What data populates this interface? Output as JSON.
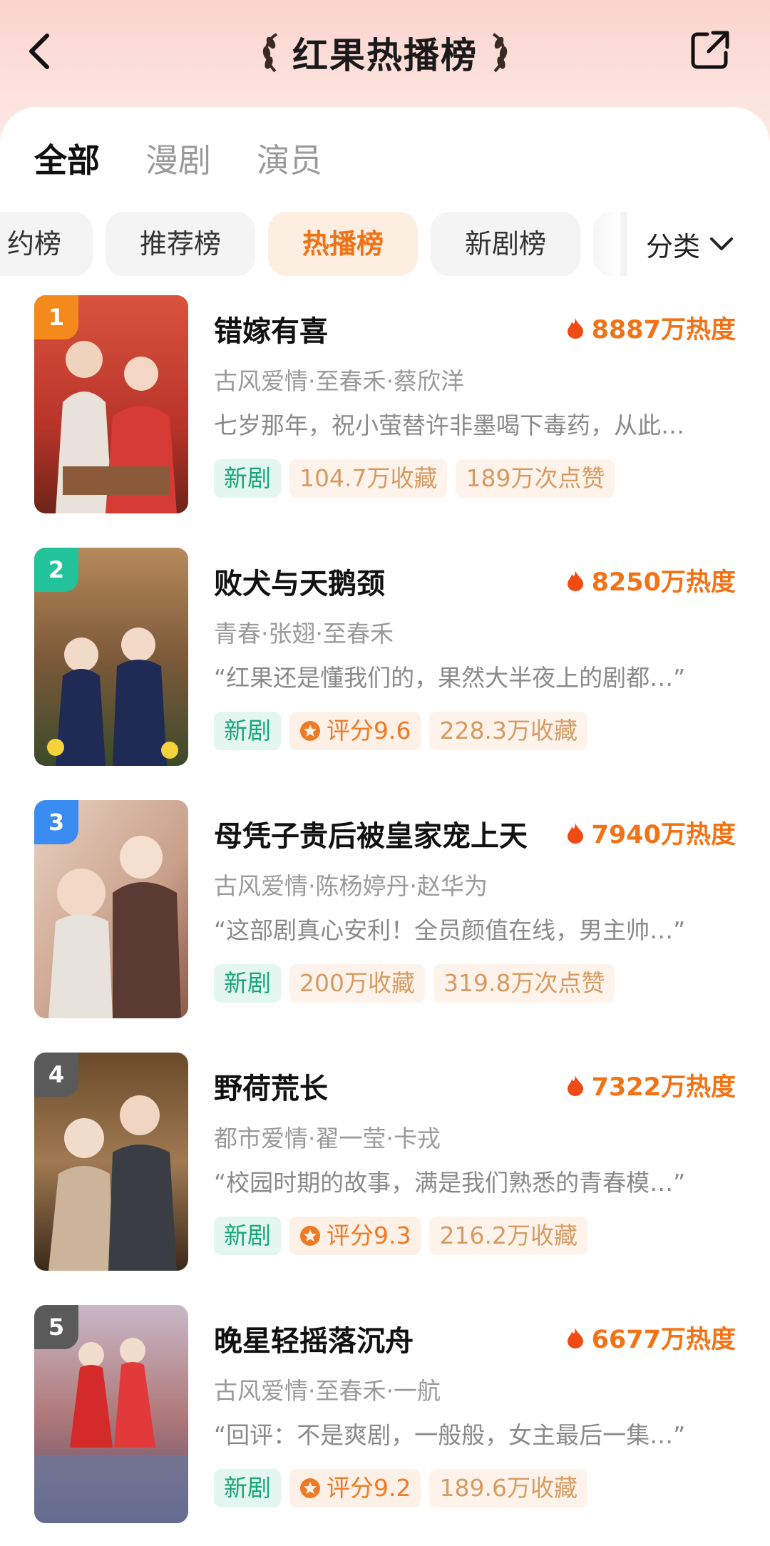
{
  "header": {
    "title": "红果热播榜",
    "back_icon": "chevron-left-icon",
    "share_icon": "share-icon"
  },
  "tabs": [
    {
      "label": "全部",
      "active": true
    },
    {
      "label": "漫剧",
      "active": false
    },
    {
      "label": "演员",
      "active": false
    }
  ],
  "chips": [
    {
      "label": "约榜",
      "active": false
    },
    {
      "label": "推荐榜",
      "active": false
    },
    {
      "label": "热播榜",
      "active": true
    },
    {
      "label": "新剧榜",
      "active": false
    }
  ],
  "category": {
    "label": "分类",
    "icon": "chevron-down-icon"
  },
  "colors": {
    "accent": "#f27216",
    "new_badge": "#19a67a",
    "rank1": "#f48a1c",
    "rank2": "#22c29a",
    "rank3": "#3a8bf2",
    "rank_other": "#5a5a5a"
  },
  "items": [
    {
      "rank": "1",
      "title": "错嫁有喜",
      "heat": "8887万热度",
      "meta": "古风爱情·至春禾·蔡欣洋",
      "desc": "七岁那年，祝小萤替许非墨喝下毒药，从此…",
      "badge_new": "新剧",
      "rating": "",
      "stat1": "104.7万收藏",
      "stat2": "189万次点赞"
    },
    {
      "rank": "2",
      "title": "败犬与天鹅颈",
      "heat": "8250万热度",
      "meta": "青春·张翅·至春禾",
      "desc": "“红果还是懂我们的，果然大半夜上的剧都…”",
      "badge_new": "新剧",
      "rating": "评分9.6",
      "stat1": "228.3万收藏",
      "stat2": ""
    },
    {
      "rank": "3",
      "title": "母凭子贵后被皇家宠上天",
      "heat": "7940万热度",
      "meta": "古风爱情·陈杨婷丹·赵华为",
      "desc": "“这部剧真心安利！全员颜值在线，男主帅…”",
      "badge_new": "新剧",
      "rating": "",
      "stat1": "200万收藏",
      "stat2": "319.8万次点赞"
    },
    {
      "rank": "4",
      "title": "野荷荒长",
      "heat": "7322万热度",
      "meta": "都市爱情·翟一莹·卡戎",
      "desc": "“校园时期的故事，满是我们熟悉的青春模…”",
      "badge_new": "新剧",
      "rating": "评分9.3",
      "stat1": "216.2万收藏",
      "stat2": ""
    },
    {
      "rank": "5",
      "title": "晚星轻摇落沉舟",
      "heat": "6677万热度",
      "meta": "古风爱情·至春禾·一航",
      "desc": "“回评：不是爽剧，一般般，女主最后一集…”",
      "badge_new": "新剧",
      "rating": "评分9.2",
      "stat1": "189.6万收藏",
      "stat2": ""
    }
  ]
}
